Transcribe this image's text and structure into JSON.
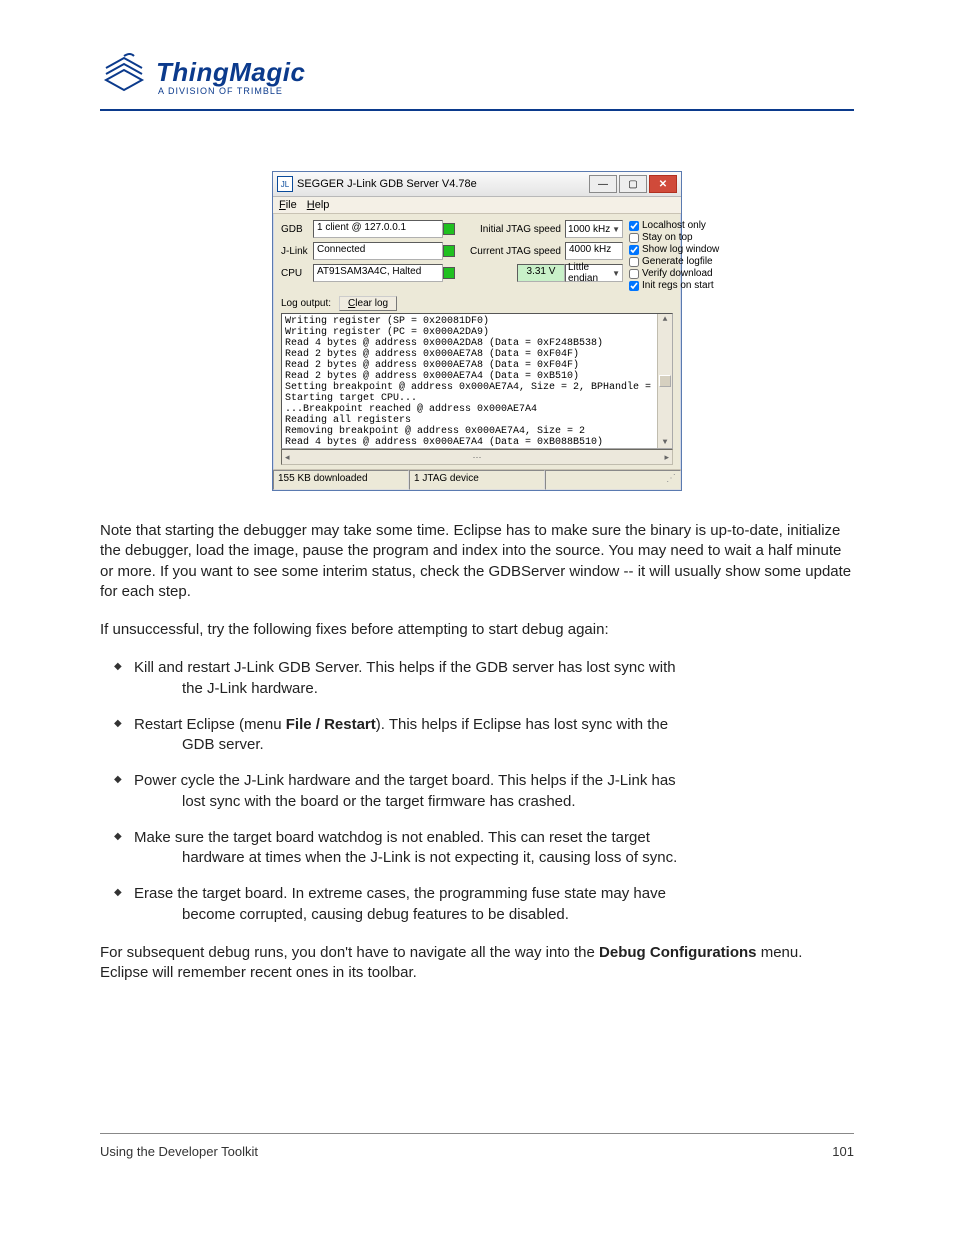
{
  "header": {
    "brand": "ThingMagic",
    "subtitle": "A DIVISION OF TRIMBLE"
  },
  "window": {
    "title": "SEGGER J-Link GDB Server V4.78e",
    "menu": {
      "file": "File",
      "help": "Help"
    },
    "labels": {
      "gdb": "GDB",
      "jlink": "J-Link",
      "cpu": "CPU",
      "initial_speed": "Initial JTAG speed",
      "current_speed": "Current JTAG speed",
      "log_output": "Log output:",
      "clear_log": "Clear log"
    },
    "values": {
      "gdb": "1 client @ 127.0.0.1",
      "jlink": "Connected",
      "cpu": "AT91SAM3A4C, Halted",
      "initial_speed": "1000 kHz",
      "current_speed": "4000 kHz",
      "voltage": "3.31 V",
      "endian": "Little endian"
    },
    "checks": {
      "localhost_only": "Localhost only",
      "stay_on_top": "Stay on top",
      "show_log_window": "Show log window",
      "generate_logfile": "Generate logfile",
      "verify_download": "Verify download",
      "init_regs_on_start": "Init regs on start"
    },
    "log_lines": [
      "Writing register (SP = 0x20081DF0)",
      "Writing register (PC = 0x000A2DA9)",
      "Read 4 bytes @ address 0x000A2DA8 (Data = 0xF248B538)",
      "Read 2 bytes @ address 0x000AE7A8 (Data = 0xF04F)",
      "Read 2 bytes @ address 0x000AE7A8 (Data = 0xF04F)",
      "Read 2 bytes @ address 0x000AE7A4 (Data = 0xB510)",
      "Setting breakpoint @ address 0x000AE7A4, Size = 2, BPHandle =",
      "Starting target CPU...",
      "...Breakpoint reached @ address 0x000AE7A4",
      "Reading all registers",
      "Removing breakpoint @ address 0x000AE7A4, Size = 2",
      "Read 4 bytes @ address 0x000AE7A4 (Data = 0xB088B510)"
    ],
    "status": {
      "left": "155 KB downloaded",
      "mid": "1 JTAG device"
    }
  },
  "body": {
    "p1": "Note that starting the debugger may take some time.  Eclipse has to make sure the binary is up-to-date, initialize the debugger, load the image, pause the program and index into the source.  You may need to wait a half minute or more.  If you want to see some interim status, check the GDBServer window -- it will usually show some update for each step.",
    "p2": "If unsuccessful, try the following fixes before attempting to start debug again:",
    "bullets": [
      {
        "first": "Kill and restart J-Link GDB Server.  This helps if the GDB server has lost sync with",
        "cont": "the J-Link hardware."
      },
      {
        "first_pre": "Restart Eclipse (menu ",
        "first_bold": "File / Restart",
        "first_post": ").  This helps if Eclipse has lost sync with the",
        "cont": "GDB server."
      },
      {
        "first": "Power cycle the J-Link hardware and the target board.  This helps if the J-Link has",
        "cont": "lost sync with the board or the target firmware has crashed."
      },
      {
        "first": "Make sure the target board watchdog is not enabled.  This can reset the target",
        "cont": "hardware at times when the J-Link is not expecting it, causing loss of sync."
      },
      {
        "first": "Erase the target board.  In extreme cases, the programming fuse state may have",
        "cont": "become corrupted, causing debug features to be disabled."
      }
    ],
    "p3_pre": "For subsequent debug runs, you don't have to navigate all the way into the ",
    "p3_bold": "Debug Configurations",
    "p3_post": " menu.  Eclipse will remember recent ones in its toolbar."
  },
  "footer": {
    "left": "Using the Developer Toolkit",
    "right": "101"
  }
}
